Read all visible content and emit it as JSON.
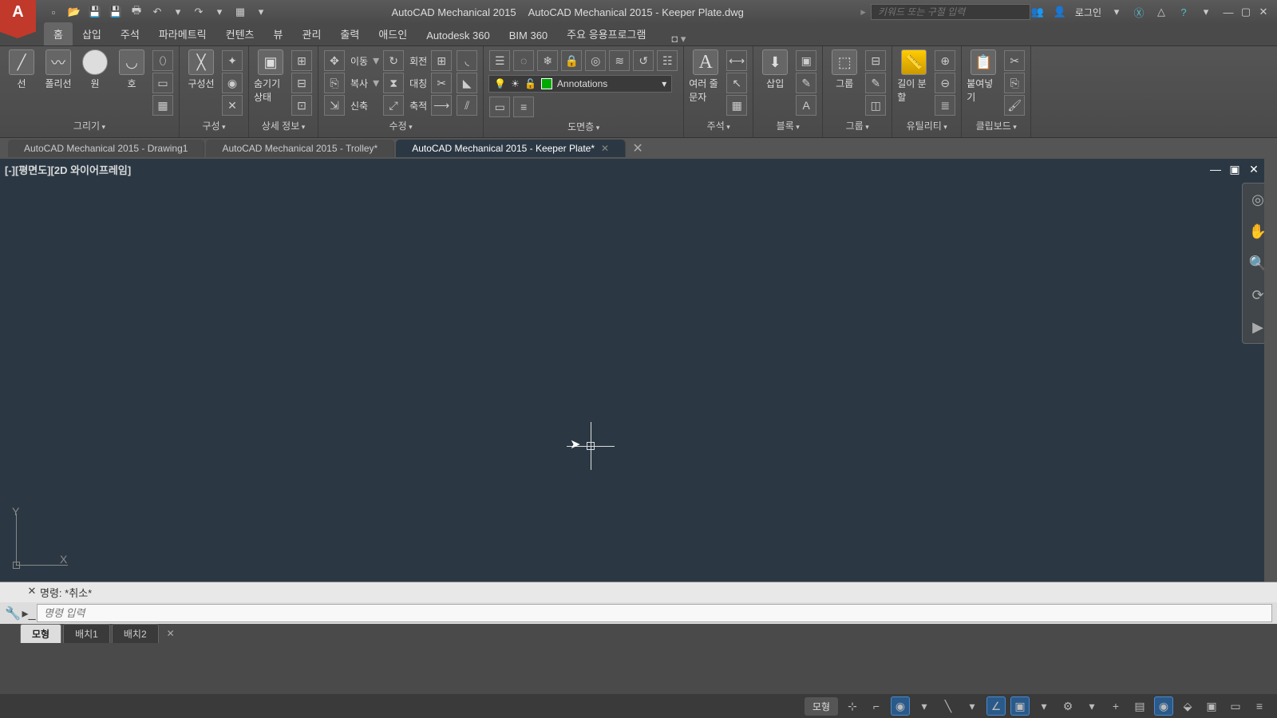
{
  "title": {
    "app": "AutoCAD Mechanical 2015",
    "file": "AutoCAD Mechanical 2015 - Keeper Plate.dwg",
    "search_placeholder": "키워드 또는 구절 입력",
    "login": "로그인"
  },
  "menu": {
    "tabs": [
      "홈",
      "삽입",
      "주석",
      "파라메트릭",
      "컨텐츠",
      "뷰",
      "관리",
      "출력",
      "애드인",
      "Autodesk 360",
      "BIM 360",
      "주요 응용프로그램"
    ]
  },
  "ribbon": {
    "draw": {
      "title": "그리기",
      "line": "선",
      "polyline": "폴리선",
      "circle": "원",
      "arc": "호"
    },
    "constr": {
      "title": "구성",
      "constrline": "구성선"
    },
    "detail": {
      "title": "상세 정보",
      "hide": "숨기기 상태"
    },
    "modify": {
      "title": "수정",
      "move": "이동",
      "copy": "복사",
      "stretch": "신축",
      "rotate": "회전",
      "mirror": "대칭",
      "scale": "축적"
    },
    "layers": {
      "title": "도면층",
      "current": "Annotations"
    },
    "annot": {
      "title": "주석",
      "mtext": "여러 줄 문자"
    },
    "block": {
      "title": "블록",
      "insert": "삽입"
    },
    "group": {
      "title": "그룹",
      "group": "그룹"
    },
    "util": {
      "title": "유틸리티",
      "measure": "길이 분할"
    },
    "clip": {
      "title": "클립보드",
      "paste": "붙여넣기"
    }
  },
  "docs": {
    "tabs": [
      {
        "label": "AutoCAD Mechanical 2015 - Drawing1"
      },
      {
        "label": "AutoCAD Mechanical 2015 - Trolley*"
      },
      {
        "label": "AutoCAD Mechanical 2015 - Keeper Plate*"
      }
    ]
  },
  "viewport": {
    "label": "[-][평면도][2D 와이어프레임]"
  },
  "ucs": {
    "x": "X",
    "y": "Y"
  },
  "cmd": {
    "prompt": "명령:",
    "last": "*취소*",
    "placeholder": "명령 입력"
  },
  "layouts": {
    "tabs": [
      "모형",
      "배치1",
      "배치2"
    ]
  },
  "status": {
    "model": "모형"
  }
}
